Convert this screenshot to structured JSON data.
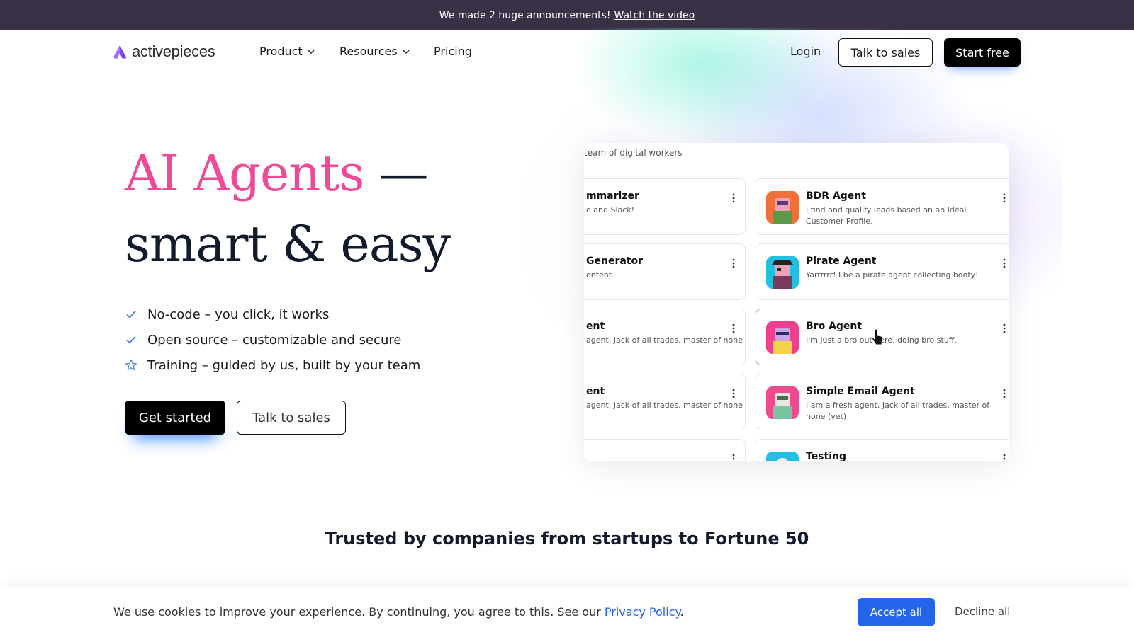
{
  "announcement": {
    "text": "We made 2 huge announcements!",
    "link": "Watch the video"
  },
  "nav": {
    "logo": "activepieces",
    "items": [
      "Product",
      "Resources",
      "Pricing"
    ],
    "login": "Login",
    "talk_to_sales": "Talk to sales",
    "start_free": "Start free"
  },
  "hero": {
    "title_highlight": "AI Agents",
    "title_dash": " —",
    "title_line2": "smart & easy",
    "bullets": [
      {
        "icon": "check-icon",
        "text": "No-code – you click, it works"
      },
      {
        "icon": "check-icon",
        "text": "Open source – customizable and secure"
      },
      {
        "icon": "star-outline-icon",
        "text": "Training – guided by us, built by your team"
      }
    ],
    "primary_cta": "Get started",
    "secondary_cta": "Talk to sales"
  },
  "agents_panel": {
    "subtitle": "team of digital workers",
    "left_cards": [
      {
        "name": "mmarizer",
        "desc": "e and Slack!"
      },
      {
        "name": "Generator",
        "desc": "ontent."
      },
      {
        "name": "ent",
        "desc": "agent, Jack of all trades, master of none"
      },
      {
        "name": "ent",
        "desc": "agent, Jack of all trades, master of none"
      },
      {
        "name": "",
        "desc": ""
      }
    ],
    "right_cards": [
      {
        "name": "BDR Agent",
        "desc": "I find and qualify leads based on an Ideal Customer Profile.",
        "color": "#f0703a"
      },
      {
        "name": "Pirate Agent",
        "desc": "Yarrrrrr! I be a pirate agent collecting booty!",
        "color": "#22bfe0"
      },
      {
        "name": "Bro Agent",
        "desc": "I'm just a bro out here, doing bro stuff.",
        "color": "#ef3f8e"
      },
      {
        "name": "Simple Email Agent",
        "desc": "I am a fresh agent, Jack of all trades, master of none (yet)",
        "color": "#ec4c8c"
      },
      {
        "name": "Testing",
        "desc": "",
        "color": "#22bfe0"
      }
    ]
  },
  "trusted": {
    "heading": "Trusted by companies from startups to Fortune 50"
  },
  "cookie": {
    "text": "We use cookies to improve your experience. By continuing, you agree to this. See our",
    "link": "Privacy Policy",
    "after_link": ".",
    "accept": "Accept all",
    "decline": "Decline all"
  },
  "colors": {
    "accent_pink": "#ee4a98",
    "announcement_bg": "#3a3147",
    "accept_blue": "#2563eb"
  }
}
